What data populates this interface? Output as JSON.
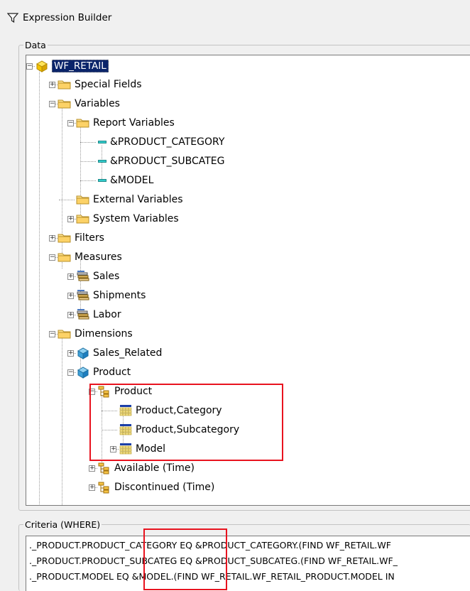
{
  "window": {
    "title": "Expression Builder",
    "icon": "filter-icon"
  },
  "data_group": {
    "label": "Data"
  },
  "criteria_group": {
    "label": "Criteria (WHERE)"
  },
  "tree": [
    {
      "label": "WF_RETAIL",
      "icon": "cube-icon",
      "selected": true
    },
    {
      "label": "Special Fields",
      "icon": "folder-icon"
    },
    {
      "label": "Variables",
      "icon": "folder-icon"
    },
    {
      "label": "Report Variables",
      "icon": "folder-icon"
    },
    {
      "label": "&PRODUCT_CATEGORY",
      "icon": "variable-icon"
    },
    {
      "label": "&PRODUCT_SUBCATEG",
      "icon": "variable-icon"
    },
    {
      "label": "&MODEL",
      "icon": "variable-icon"
    },
    {
      "label": "External Variables",
      "icon": "folder-icon"
    },
    {
      "label": "System Variables",
      "icon": "folder-icon"
    },
    {
      "label": "Filters",
      "icon": "folder-icon"
    },
    {
      "label": "Measures",
      "icon": "folder-icon"
    },
    {
      "label": "Sales",
      "icon": "measure-group-icon"
    },
    {
      "label": "Shipments",
      "icon": "measure-group-icon"
    },
    {
      "label": "Labor",
      "icon": "measure-group-icon"
    },
    {
      "label": "Dimensions",
      "icon": "folder-icon"
    },
    {
      "label": "Sales_Related",
      "icon": "dimension-icon"
    },
    {
      "label": "Product",
      "icon": "dimension-icon"
    },
    {
      "label": "Product",
      "icon": "hierarchy-icon"
    },
    {
      "label": "Product,Category",
      "icon": "level-icon"
    },
    {
      "label": "Product,Subcategory",
      "icon": "level-icon"
    },
    {
      "label": "Model",
      "icon": "level-icon"
    },
    {
      "label": "Available (Time)",
      "icon": "hierarchy-icon"
    },
    {
      "label": "Discontinued (Time)",
      "icon": "hierarchy-icon"
    }
  ],
  "criteria": [
    "._PRODUCT.PRODUCT_CATEGORY EQ &PRODUCT_CATEGORY.(FIND WF_RETAIL.WF",
    "._PRODUCT.PRODUCT_SUBCATEG EQ &PRODUCT_SUBCATEG.(FIND WF_RETAIL.WF_",
    "._PRODUCT.MODEL EQ &MODEL.(FIND WF_RETAIL.WF_RETAIL_PRODUCT.MODEL IN"
  ],
  "colors": {
    "highlight": "#e8131f",
    "selection": "#0a246a"
  }
}
